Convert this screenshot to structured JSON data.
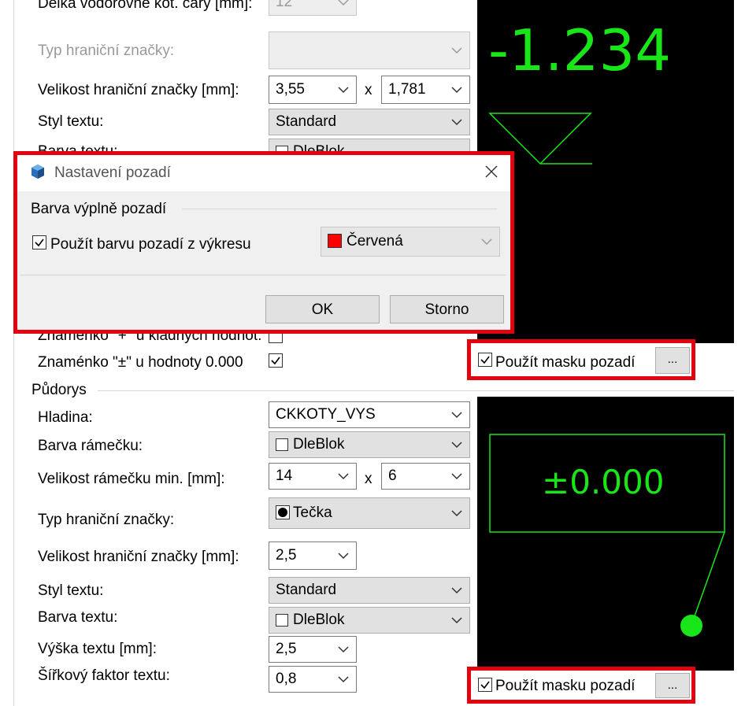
{
  "top": {
    "row_cut_label": "Délka vodorovné kót. čáry [mm]:",
    "row_cut_value": "12",
    "boundary_type_label": "Typ hraniční značky:",
    "boundary_size_label": "Velikost hraniční značky [mm]:",
    "boundary_size_w": "3,55",
    "boundary_size_h": "1,781",
    "size_separator": "x",
    "text_style_label": "Styl textu:",
    "text_style_value": "Standard",
    "text_color_label": "Barva textu:",
    "text_color_value": "DleBlok",
    "plus_sign_label": "Znaménko \"+\" u kladných hodnot:",
    "pm_sign_label": "Znaménko \"±\" u hodnoty 0.000",
    "preview_value": "-1.234",
    "mask_label": "Použít masku pozadí",
    "mask_button": "..."
  },
  "dialog": {
    "title": "Nastavení pozadí",
    "group_label": "Barva výplně pozadí",
    "use_bg_label": "Použít barvu pozadí z výkresu",
    "use_bg_checked": true,
    "color_value": "Červená",
    "color_swatch": "#ff0000",
    "ok_label": "OK",
    "cancel_label": "Storno"
  },
  "pudorys": {
    "section_label": "Půdorys",
    "layer_label": "Hladina:",
    "layer_value": "CKKOTY_VYS",
    "frame_color_label": "Barva rámečku:",
    "frame_color_value": "DleBlok",
    "frame_size_label": "Velikost rámečku min. [mm]:",
    "frame_size_w": "14",
    "frame_size_h": "6",
    "size_separator": "x",
    "boundary_type_label": "Typ hraniční značky:",
    "boundary_type_value": "Tečka",
    "boundary_size_label": "Velikost hraniční značky [mm]:",
    "boundary_size_value": "2,5",
    "text_style_label": "Styl textu:",
    "text_style_value": "Standard",
    "text_color_label": "Barva textu:",
    "text_color_value": "DleBlok",
    "text_height_label": "Výška textu [mm]:",
    "text_height_value": "2,5",
    "width_factor_label": "Šířkový faktor textu:",
    "width_factor_value": "0,8",
    "preview_value": "±0.000",
    "mask_label": "Použít masku pozadí",
    "mask_button": "..."
  },
  "colors": {
    "highlight_red": "#e3000f",
    "preview_green": "#19e619",
    "preview_bg": "#000000"
  }
}
